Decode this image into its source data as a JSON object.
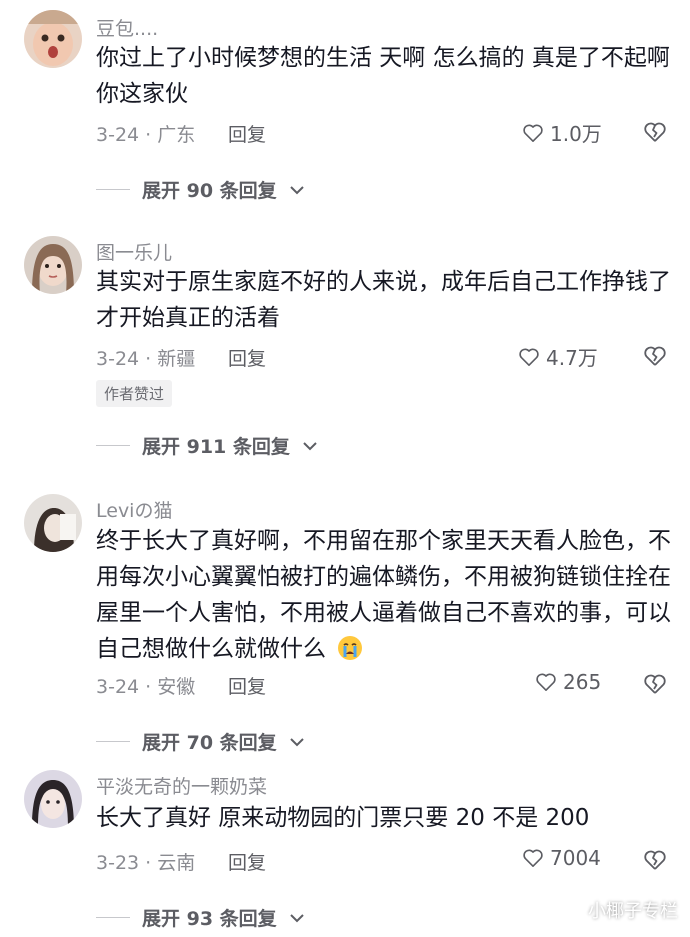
{
  "colors": {
    "text": "#161823",
    "muted": "#8a8b91",
    "secondary": "#5c5d63",
    "badge_bg": "#f1f1f2"
  },
  "reply_label": "回复",
  "comments": [
    {
      "username": "豆包....",
      "text": "你过上了小时候梦想的生活 天啊 怎么搞的 真是了不起啊你这家伙",
      "date_location": "3-24 · 广东",
      "likes": "1.0万",
      "expand": "展开 90 条回复",
      "icons": [
        "heart-icon",
        "broken-heart-icon",
        "chevron-down-icon"
      ]
    },
    {
      "username": "图一乐儿",
      "text": "其实对于原生家庭不好的人来说，成年后自己工作挣钱了才开始真正的活着",
      "date_location": "3-24 · 新疆",
      "likes": "4.7万",
      "badge": "作者赞过",
      "expand": "展开 911 条回复",
      "icons": [
        "heart-icon",
        "broken-heart-icon",
        "chevron-down-icon"
      ]
    },
    {
      "username": "Leviの猫",
      "text": "终于长大了真好啊，不用留在那个家里天天看人脸色，不用每次小心翼翼怕被打的遍体鳞伤，不用被狗链锁住拴在屋里一个人害怕，不用被人逼着做自己不喜欢的事，可以自己想做什么就做什么",
      "date_location": "3-24 · 安徽",
      "likes": "265",
      "expand": "展开 70 条回复",
      "icons": [
        "crying-emoji-icon",
        "heart-icon",
        "broken-heart-icon",
        "chevron-down-icon"
      ]
    },
    {
      "username": "平淡无奇的一颗奶菜",
      "text": "长大了真好 原来动物园的门票只要 20 不是 200",
      "date_location": "3-23 · 云南",
      "likes": "7004",
      "expand": "展开 93 条回复",
      "icons": [
        "heart-icon",
        "broken-heart-icon",
        "chevron-down-icon"
      ]
    }
  ],
  "watermark": "小椰子专栏"
}
